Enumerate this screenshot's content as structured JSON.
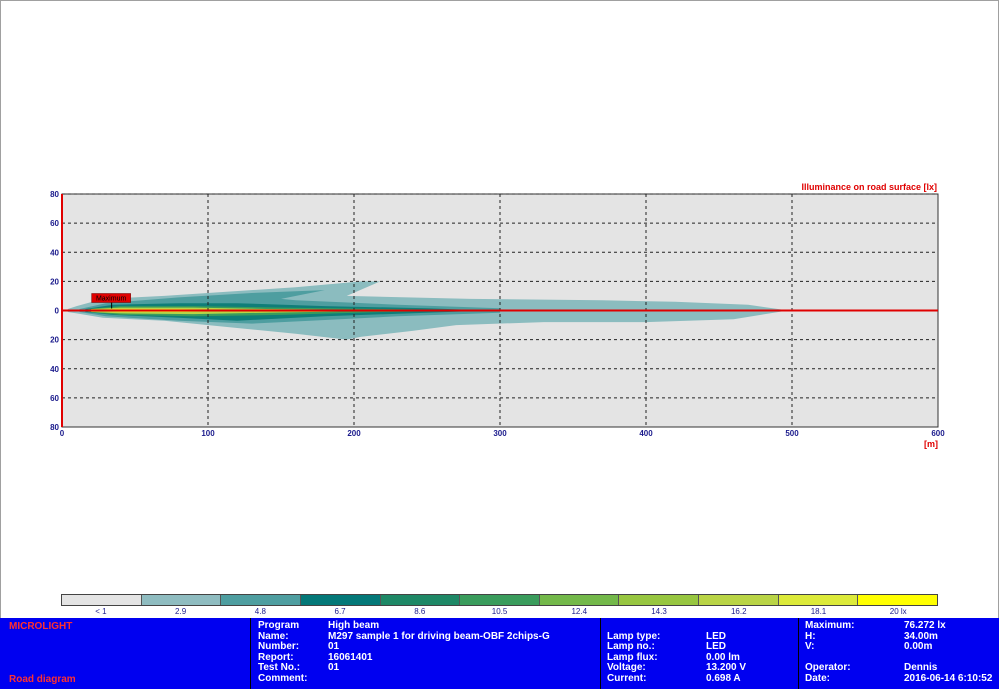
{
  "chart_data": {
    "type": "heatmap",
    "title": "Illuminance on road surface [lx]",
    "xlabel": "[m]",
    "ylabel": "",
    "xlim": [
      0,
      600
    ],
    "ylim": [
      -80,
      80
    ],
    "x_ticks": [
      0,
      100,
      200,
      300,
      400,
      500,
      600
    ],
    "y_ticks": [
      80,
      60,
      40,
      20,
      0,
      20,
      40,
      60,
      80
    ],
    "grid": true,
    "maximum_marker": {
      "label": "Maximum",
      "x": 34.0,
      "y": 0.0
    },
    "contours": [
      {
        "level": 2.9,
        "color": "#8bbcbf",
        "points": [
          [
            4,
            1
          ],
          [
            10,
            3
          ],
          [
            28,
            8
          ],
          [
            70,
            10
          ],
          [
            160,
            16
          ],
          [
            205,
            20
          ],
          [
            218,
            20
          ],
          [
            195,
            10
          ],
          [
            280,
            8
          ],
          [
            370,
            7
          ],
          [
            420,
            6
          ],
          [
            470,
            4
          ],
          [
            494,
            0.5
          ],
          [
            494,
            -0.5
          ],
          [
            460,
            -6
          ],
          [
            400,
            -8
          ],
          [
            330,
            -8
          ],
          [
            270,
            -10
          ],
          [
            240,
            -14
          ],
          [
            205,
            -18
          ],
          [
            195,
            -20
          ],
          [
            160,
            -16
          ],
          [
            120,
            -12
          ],
          [
            70,
            -7
          ],
          [
            28,
            -5
          ],
          [
            10,
            -2
          ],
          [
            4,
            -1
          ]
        ]
      },
      {
        "level": 4.8,
        "color": "#4e9ea0",
        "points": [
          [
            12,
            1
          ],
          [
            30,
            5
          ],
          [
            80,
            9
          ],
          [
            130,
            12
          ],
          [
            180,
            14
          ],
          [
            150,
            8
          ],
          [
            160,
            7
          ],
          [
            230,
            4
          ],
          [
            300,
            1.5
          ],
          [
            300,
            -1.5
          ],
          [
            230,
            -4
          ],
          [
            170,
            -7
          ],
          [
            130,
            -9
          ],
          [
            80,
            -7
          ],
          [
            30,
            -4
          ],
          [
            12,
            -1
          ]
        ]
      },
      {
        "level": 6.7,
        "color": "#0f7e78",
        "points": [
          [
            16,
            1
          ],
          [
            35,
            4
          ],
          [
            80,
            5
          ],
          [
            120,
            5
          ],
          [
            180,
            3
          ],
          [
            250,
            1.5
          ],
          [
            285,
            0.3
          ],
          [
            285,
            -0.3
          ],
          [
            250,
            -1.5
          ],
          [
            180,
            -4
          ],
          [
            120,
            -7
          ],
          [
            80,
            -5
          ],
          [
            35,
            -3
          ],
          [
            16,
            -1
          ]
        ]
      },
      {
        "level": 8.6,
        "color": "#3a9c5c",
        "points": [
          [
            18,
            1
          ],
          [
            40,
            3
          ],
          [
            90,
            3
          ],
          [
            150,
            2
          ],
          [
            220,
            1
          ],
          [
            275,
            0.3
          ],
          [
            275,
            -0.3
          ],
          [
            220,
            -1
          ],
          [
            150,
            -3
          ],
          [
            90,
            -4
          ],
          [
            40,
            -3
          ],
          [
            18,
            -1
          ]
        ]
      },
      {
        "level": 12.4,
        "color": "#b9d446",
        "points": [
          [
            20,
            1
          ],
          [
            40,
            2
          ],
          [
            90,
            2
          ],
          [
            140,
            1
          ],
          [
            200,
            0.5
          ],
          [
            200,
            -0.5
          ],
          [
            140,
            -1.5
          ],
          [
            90,
            -2.5
          ],
          [
            40,
            -2
          ],
          [
            20,
            -1
          ]
        ]
      },
      {
        "level": 18.1,
        "color": "#eeee30",
        "points": [
          [
            22,
            0.5
          ],
          [
            40,
            1
          ],
          [
            80,
            1
          ],
          [
            110,
            0.5
          ],
          [
            110,
            -0.5
          ],
          [
            80,
            -1
          ],
          [
            40,
            -1
          ],
          [
            22,
            -0.5
          ]
        ]
      }
    ]
  },
  "legend": {
    "labels": [
      "< 1",
      "2.9",
      "4.8",
      "6.7",
      "8.6",
      "10.5",
      "12.4",
      "14.3",
      "16.2",
      "18.1",
      "20 lx"
    ],
    "colors": [
      "#e4e4e4",
      "#8fbcc0",
      "#4e9ea0",
      "#047878",
      "#1e8866",
      "#3a9c5c",
      "#73b84a",
      "#97c640",
      "#b9d446",
      "#dcea3a",
      "#ffff00"
    ]
  },
  "info": {
    "brand": "MICROLIGHT",
    "diagram": "Road diagram",
    "left_labels": [
      "Program",
      "Name:",
      "Number:",
      "Report:",
      "Test No.:",
      "Comment:"
    ],
    "left_values": [
      "High beam",
      "M297 sample 1 for driving beam-OBF 2chips-G",
      "01",
      "16061401",
      "01",
      ""
    ],
    "mid_labels": [
      "Lamp type:",
      "Lamp no.:",
      "Lamp flux:",
      "Voltage:",
      "Current:"
    ],
    "mid_values": [
      "LED",
      "LED",
      "0.00 lm",
      "13.200 V",
      "0.698 A"
    ],
    "right_labels": [
      "Maximum:",
      "H:",
      "V:",
      "",
      "Operator:",
      "Date:"
    ],
    "right_values": [
      "76.272 lx",
      "34.00m",
      "0.00m",
      "",
      "Dennis",
      "2016-06-14 6:10:52"
    ]
  },
  "colors": {
    "axis_red": "#e00000",
    "panel_blue": "#0000f0",
    "tick_blue": "#1a1a8c"
  }
}
